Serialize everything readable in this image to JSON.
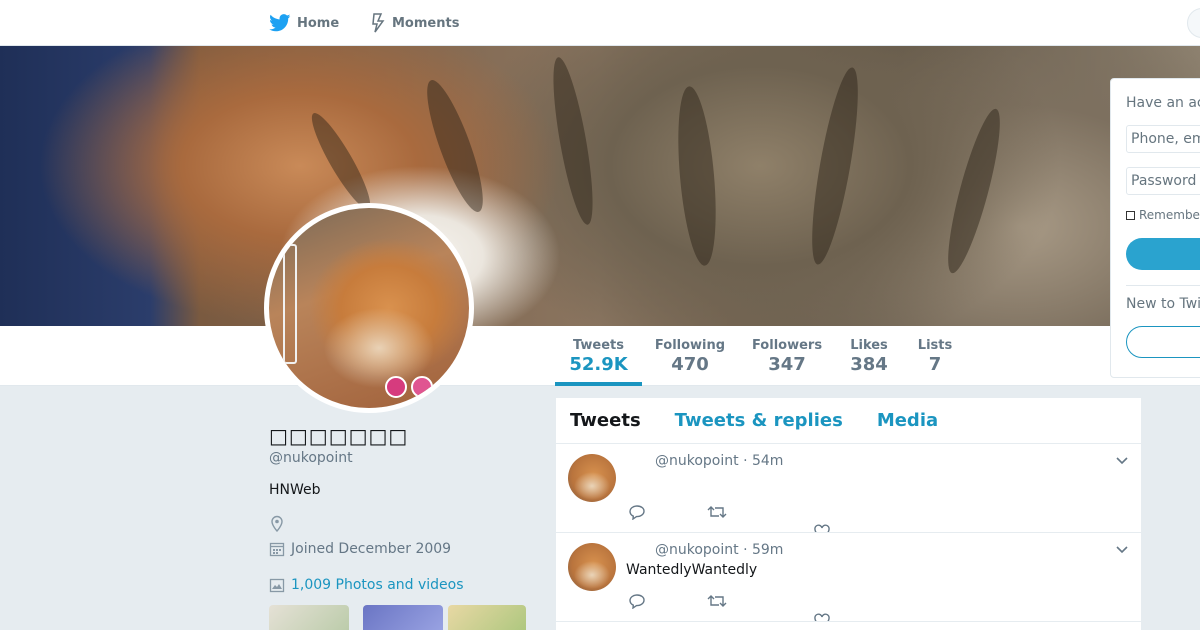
{
  "nav": {
    "home_label": "Home",
    "moments_label": "Moments"
  },
  "profile": {
    "name": "□□□□□□□",
    "handle": "@nukopoint",
    "bio": "HNWeb",
    "joined": "Joined December 2009",
    "photos_link": "1,009 Photos and videos"
  },
  "stats": [
    {
      "label": "Tweets",
      "value": "52.9K",
      "active": true
    },
    {
      "label": "Following",
      "value": "470"
    },
    {
      "label": "Followers",
      "value": "347"
    },
    {
      "label": "Likes",
      "value": "384"
    },
    {
      "label": "Lists",
      "value": "7"
    }
  ],
  "timeline": {
    "tabs": [
      "Tweets",
      "Tweets & replies",
      "Media"
    ],
    "tweets": [
      {
        "header": "@nukopoint · 54m",
        "text": ""
      },
      {
        "header": "@nukopoint · 59m",
        "text": "WantedlyWantedly"
      }
    ]
  },
  "login": {
    "title": "Have an ac",
    "phone_placeholder": "Phone, em",
    "password_placeholder": "Password",
    "remember": "Remember",
    "new_to": "New to Twi"
  },
  "colors": {
    "accent": "#1b95c0",
    "twitter_blue": "#1da1f2"
  }
}
